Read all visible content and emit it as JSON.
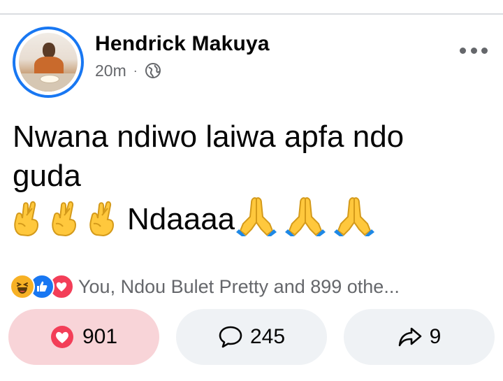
{
  "post": {
    "author": "Hendrick Makuya",
    "time": "20m",
    "separator": "·",
    "audience_icon": "globe-icon",
    "lines": [
      "Nwana ndiwo laiwa apfa ndo",
      "guda"
    ],
    "emoji_line_word": "Ndaaaa",
    "leading_emojis": [
      "crossed-fingers-emoji",
      "crossed-fingers-emoji",
      "crossed-fingers-emoji"
    ],
    "trailing_emojis": [
      "folded-hands-emoji",
      "folded-hands-emoji",
      "folded-hands-emoji"
    ]
  },
  "reactions": {
    "icons": [
      "haha-reaction-icon",
      "like-reaction-icon",
      "love-reaction-icon"
    ],
    "summary": "You, Ndou Bulet Pretty and 899 othe..."
  },
  "actions": {
    "love_count": "901",
    "comment_count": "245",
    "share_count": "9"
  },
  "colors": {
    "brand_blue": "#1877f2",
    "love_red": "#f33e58",
    "haha_yellow": "#f7b125",
    "love_button_bg": "#f8d4d8",
    "neutral_button_bg": "#eff2f5",
    "secondary_text": "#65676b"
  }
}
